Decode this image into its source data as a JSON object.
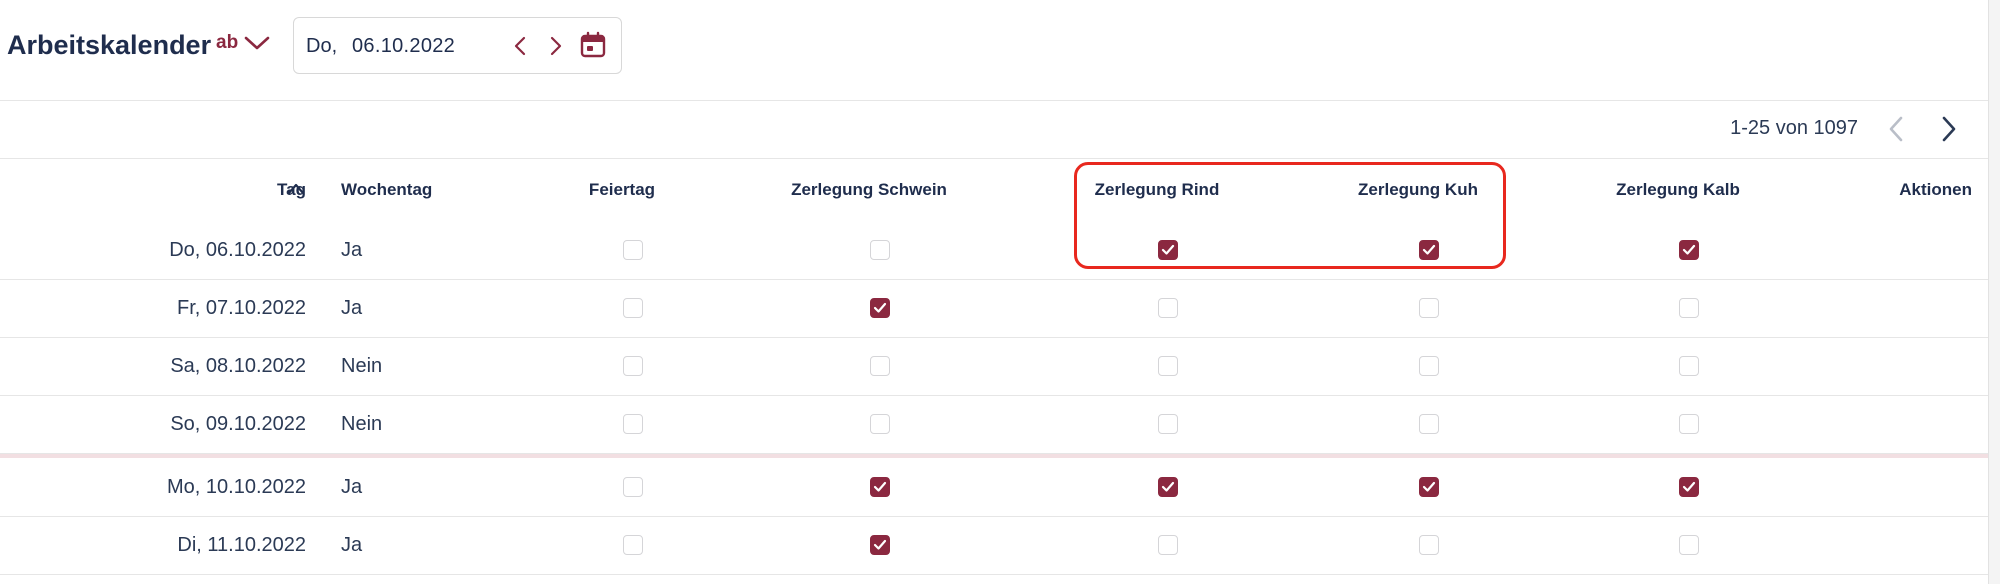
{
  "header": {
    "title": "Arbeitskalender",
    "sort_toggle_label": "ab",
    "date_day": "Do,",
    "date_value": "06.10.2022"
  },
  "pagination": {
    "info": "1-25 von 1097"
  },
  "columns": {
    "tag": "Tag",
    "wochentag": "Wochentag",
    "feiertag": "Feiertag",
    "schwein": "Zerlegung Schwein",
    "rind": "Zerlegung Rind",
    "kuh": "Zerlegung Kuh",
    "kalb": "Zerlegung Kalb",
    "aktionen": "Aktionen"
  },
  "rows": [
    {
      "date": "Do, 06.10.2022",
      "weekday": "Ja",
      "feiertag": false,
      "schwein": false,
      "rind": true,
      "kuh": true,
      "kalb": true
    },
    {
      "date": "Fr, 07.10.2022",
      "weekday": "Ja",
      "feiertag": false,
      "schwein": true,
      "rind": false,
      "kuh": false,
      "kalb": false
    },
    {
      "date": "Sa, 08.10.2022",
      "weekday": "Nein",
      "feiertag": false,
      "schwein": false,
      "rind": false,
      "kuh": false,
      "kalb": false
    },
    {
      "date": "So, 09.10.2022",
      "weekday": "Nein",
      "feiertag": false,
      "schwein": false,
      "rind": false,
      "kuh": false,
      "kalb": false
    },
    {
      "date": "Mo, 10.10.2022",
      "weekday": "Ja",
      "feiertag": false,
      "schwein": true,
      "rind": true,
      "kuh": true,
      "kalb": true
    },
    {
      "date": "Di, 11.10.2022",
      "weekday": "Ja",
      "feiertag": false,
      "schwein": true,
      "rind": false,
      "kuh": false,
      "kalb": false
    }
  ],
  "colors": {
    "accent": "#8b2840",
    "text": "#2b3a55",
    "highlight": "#e8281e"
  }
}
